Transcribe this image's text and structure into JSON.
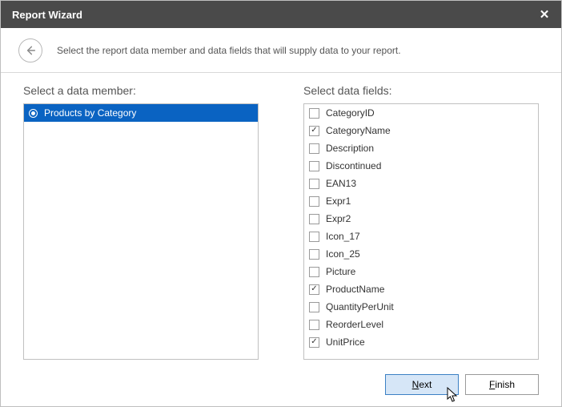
{
  "window": {
    "title": "Report Wizard",
    "close_glyph": "✕"
  },
  "subheader": {
    "description": "Select the report data member and data fields that will supply data to your report."
  },
  "labels": {
    "data_member": "Select a data member:",
    "data_fields": "Select data fields:"
  },
  "members": [
    {
      "label": "Products by Category",
      "selected": true
    }
  ],
  "fields": [
    {
      "label": "CategoryID",
      "checked": false
    },
    {
      "label": "CategoryName",
      "checked": true
    },
    {
      "label": "Description",
      "checked": false
    },
    {
      "label": "Discontinued",
      "checked": false
    },
    {
      "label": "EAN13",
      "checked": false
    },
    {
      "label": "Expr1",
      "checked": false
    },
    {
      "label": "Expr2",
      "checked": false
    },
    {
      "label": "Icon_17",
      "checked": false
    },
    {
      "label": "Icon_25",
      "checked": false
    },
    {
      "label": "Picture",
      "checked": false
    },
    {
      "label": "ProductName",
      "checked": true
    },
    {
      "label": "QuantityPerUnit",
      "checked": false
    },
    {
      "label": "ReorderLevel",
      "checked": false
    },
    {
      "label": "UnitPrice",
      "checked": true
    }
  ],
  "buttons": {
    "next": "Next",
    "finish": "Finish"
  }
}
